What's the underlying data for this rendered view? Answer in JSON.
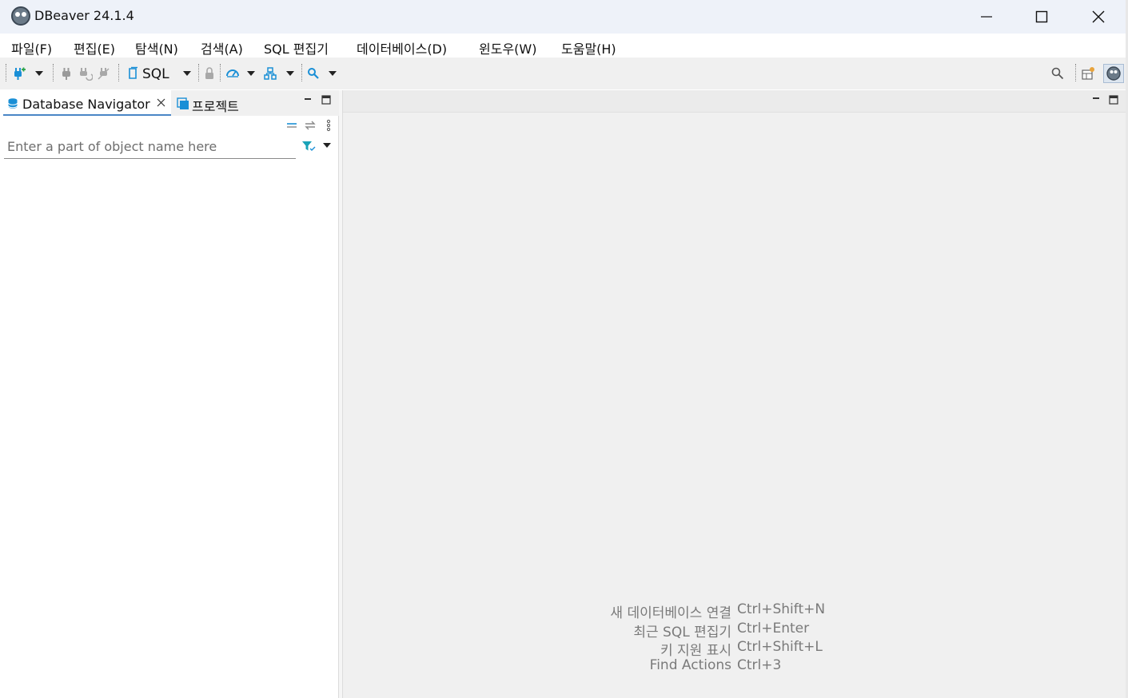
{
  "window": {
    "title": "DBeaver 24.1.4"
  },
  "menu": {
    "items": [
      "파일(F)",
      "편집(E)",
      "탐색(N)",
      "검색(A)",
      "SQL 편집기",
      "데이터베이스(D)",
      "윈도우(W)",
      "도움말(H)"
    ]
  },
  "toolbar": {
    "sql_label": "SQL",
    "accent": "#1a8fd6"
  },
  "navigator": {
    "tab_label": "Database Navigator",
    "projects_tab_label": "프로젝트",
    "filter_placeholder": "Enter a part of object name here",
    "filter_value": ""
  },
  "editor": {
    "hints": [
      {
        "label": "새 데이터베이스 연결",
        "shortcut": "Ctrl+Shift+N"
      },
      {
        "label": "최근 SQL 편집기",
        "shortcut": "Ctrl+Enter"
      },
      {
        "label": "키 지원 표시",
        "shortcut": "Ctrl+Shift+L"
      },
      {
        "label": "Find Actions",
        "shortcut": "Ctrl+3"
      }
    ]
  }
}
